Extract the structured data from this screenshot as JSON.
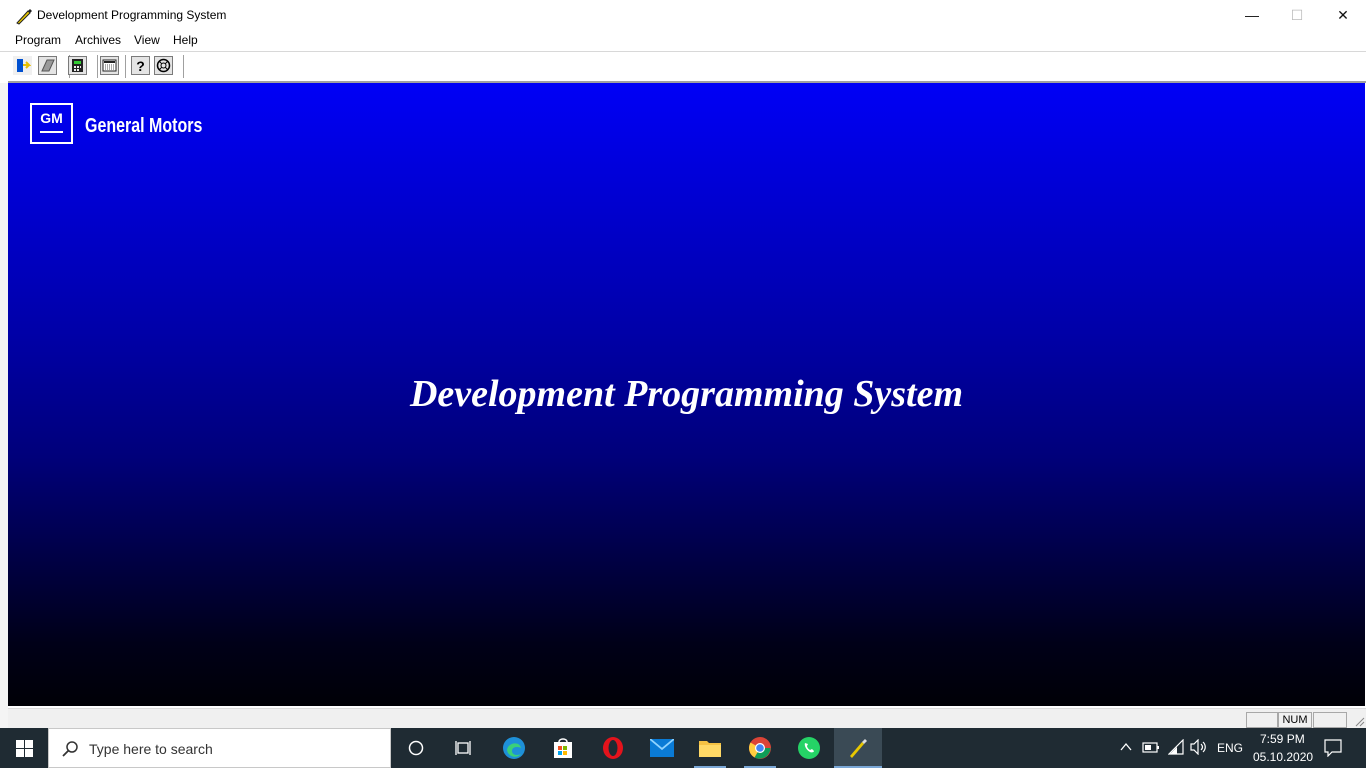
{
  "window": {
    "title": "Development Programming System",
    "minimize_glyph": "—",
    "maximize_glyph": "☐",
    "close_glyph": "✕"
  },
  "menu": {
    "items": [
      "Program",
      "Archives",
      "View",
      "Help"
    ]
  },
  "toolbar": {
    "buttons": [
      "exit-icon",
      "erase-icon",
      "calculator-icon",
      "keyboard-icon",
      "help-icon",
      "about-icon"
    ]
  },
  "splash": {
    "logo_text": "GM",
    "company": "General Motors",
    "title": "Development Programming System"
  },
  "statusbar": {
    "num_indicator": "NUM"
  },
  "taskbar": {
    "search_placeholder": "Type here to search",
    "apps": [
      "cortana-icon",
      "task-view-icon",
      "edge-icon",
      "store-icon",
      "opera-icon",
      "mail-icon",
      "file-explorer-icon",
      "chrome-icon",
      "whatsapp-icon",
      "dps-app-icon"
    ],
    "language": "ENG",
    "time": "7:59 PM",
    "date": "05.10.2020"
  },
  "colors": {
    "canvas_top": "#0000f6",
    "canvas_bottom": "#000006",
    "taskbar": "#1f2b33"
  }
}
